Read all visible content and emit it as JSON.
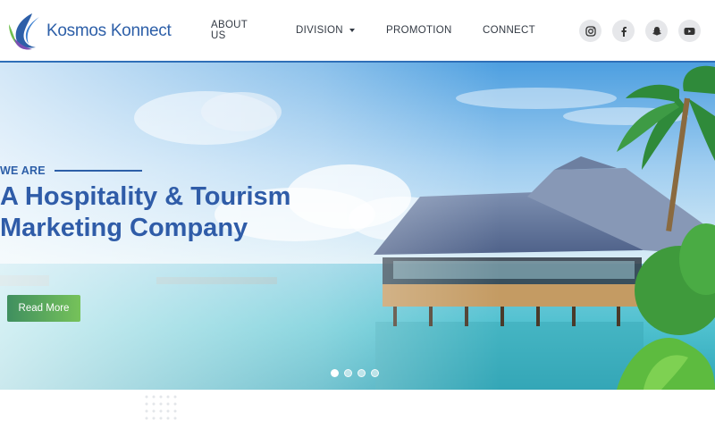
{
  "brand": {
    "name": "Kosmos Konnect"
  },
  "nav": {
    "items": [
      {
        "label": "ABOUT US",
        "has_dropdown": false
      },
      {
        "label": "DIVISION",
        "has_dropdown": true
      },
      {
        "label": "PROMOTION",
        "has_dropdown": false
      },
      {
        "label": "CONNECT",
        "has_dropdown": false
      }
    ]
  },
  "socials": [
    "instagram-icon",
    "facebook-icon",
    "snapchat-icon",
    "youtube-icon"
  ],
  "hero": {
    "eyebrow": "WE ARE",
    "headline_line1": "A Hospitality & Tourism",
    "headline_line2": "Marketing Company",
    "cta_label": "Read More",
    "slides": 4,
    "active_slide": 1
  },
  "colors": {
    "brand_blue": "#2d5fa8",
    "cta_green": "#5aa65c",
    "header_border": "#2f6fb8"
  }
}
